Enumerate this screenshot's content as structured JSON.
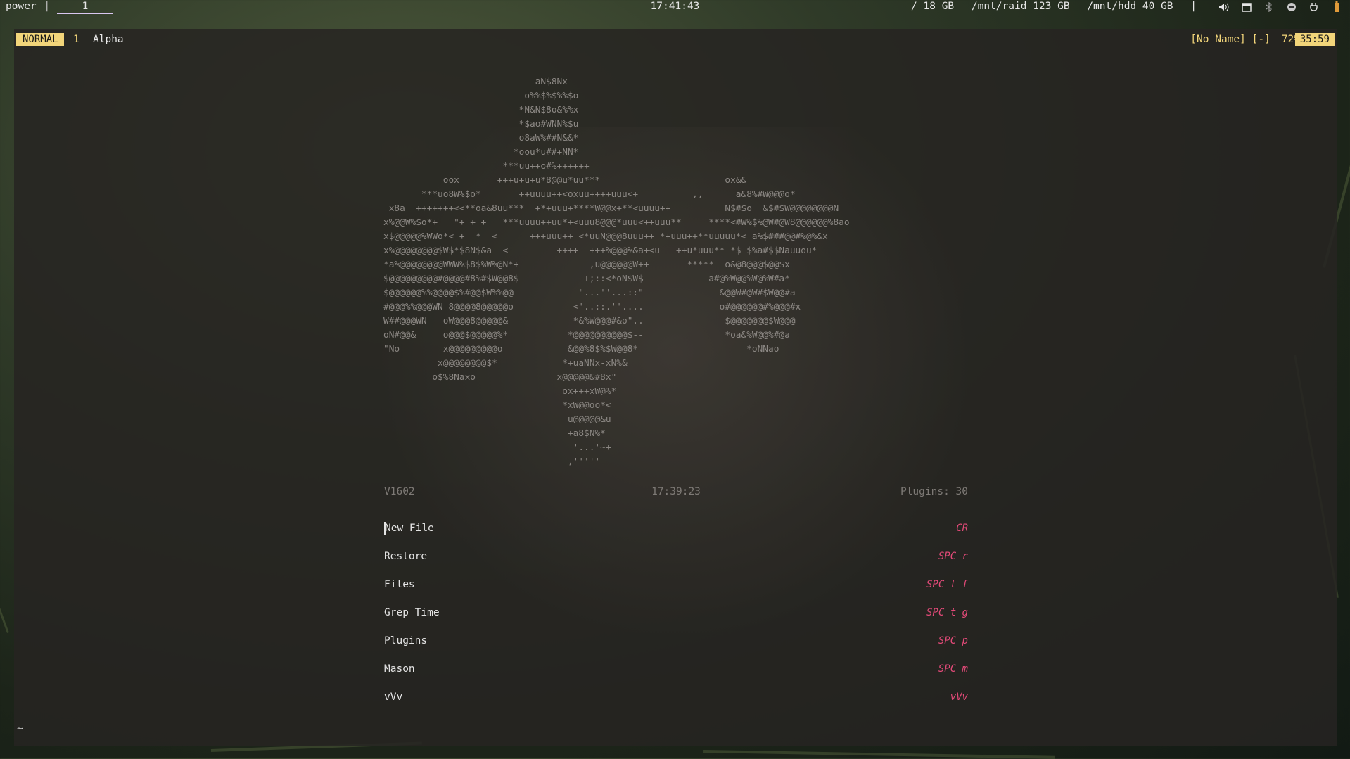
{
  "topbar": {
    "workspace_label": "power",
    "separator": "|",
    "active_workspace": "1",
    "clock": "17:41:43",
    "disks": [
      "/ 18 GB",
      "/mnt/raid 123 GB",
      "/mnt/hdd 40 GB"
    ],
    "disk_separator": "|",
    "tray_icons": [
      "volume-icon",
      "window-icon",
      "bluetooth-icon",
      "network-icon",
      "power-plug-icon"
    ]
  },
  "statusline": {
    "mode": "NORMAL",
    "buffer_number": "1",
    "buffer_name": "Alpha",
    "file_name": "[No Name] [-]",
    "percent": "72%",
    "time": "35:59"
  },
  "dashboard": {
    "ascii_art": "                            aN$8Nx\n                          o%%$%$%%$o\n                         *N&N$8o&%%x\n                         *$ao#WNN%$u\n                         o8aW%##N&&*\n                        *oou*u##+NN*\n                      ***uu++o#%++++++\n           oox       +++u+u+u*8@@u*uu***                       ox&&\n       ***uo8W%$o*       ++uuuu++<oxuu++++uuu<+          ,,      a&8%#W@@@o*\n x8a  +++++++<<**oa&8uu***  +*+uuu+****W@@x+**<uuuu++          N$#$o  &$#$W@@@@@@@@N\nx%@@W%$o*+   \"+ + +   ***uuuu++uu*+<uuu8@@@*uuu<++uuu**     ****<#W%$%@W#@W8@@@@@@%8ao\nx$@@@@@%WWo*< +  *  <      +++uuu++ <*uuN@@@8uuu++ *+uuu++**uuuuu*< a%$###@@#%@%&x\nx%@@@@@@@@$W$*$8N$&a  <         ++++  +++%@@@%&a+<u   ++u*uuu** *$ $%a#$$Nauuou*\n*a%@@@@@@@@WWW%$8$%W%@N*+             ,u@@@@@@W++       *****  o&@8@@@$@@$x\n$@@@@@@@@@#@@@@#8%#$W@@8$            +;::<*oN$W$            a#@%W@@%W@%W#a*\n$@@@@@@%%@@@@$%#@@$W%%@@            \"...''...::\"              &@@W#@W#$W@@#a\n#@@@%%@@@WN 8@@@@8@@@@@o           <'..::.''....-             o#@@@@@@#%@@@#x\nW##@@@WN   oW@@@8@@@@@&            *&%W@@@#&o\"..-              $@@@@@@@$W@@@\noN#@@&     o@@@$@@@@@%*           *@@@@@@@@@@$--               *oa&%W@@%#@a\n\"No        x@@@@@@@@@o            &@@%8$%$W@@8*                    *oNNao\n          x@@@@@@@@$*            *+uaNNx-xN%&\n         o$%8Naxo               x@@@@@&#8x\"\n                                 ox+++xW@%*\n                                 *xW@@oo*<\n                                  u@@@@@&u\n                                  +a8$N%*\n                                   '...'~+\n                                  ,'''''",
    "version": "V1602",
    "time": "17:39:23",
    "plugins": "Plugins: 30",
    "menu": [
      {
        "label": "New File",
        "key": "CR",
        "name": "new-file"
      },
      {
        "label": "Restore",
        "key": "SPC r",
        "name": "restore"
      },
      {
        "label": "Files",
        "key": "SPC t f",
        "name": "files"
      },
      {
        "label": "Grep Time",
        "key": "SPC t g",
        "name": "grep-time"
      },
      {
        "label": "Plugins",
        "key": "SPC p",
        "name": "plugins"
      },
      {
        "label": "Mason",
        "key": "SPC m",
        "name": "mason"
      },
      {
        "label": "vVv",
        "key": "vVv",
        "name": "vvv"
      }
    ]
  },
  "buffer_end_marker": "~"
}
